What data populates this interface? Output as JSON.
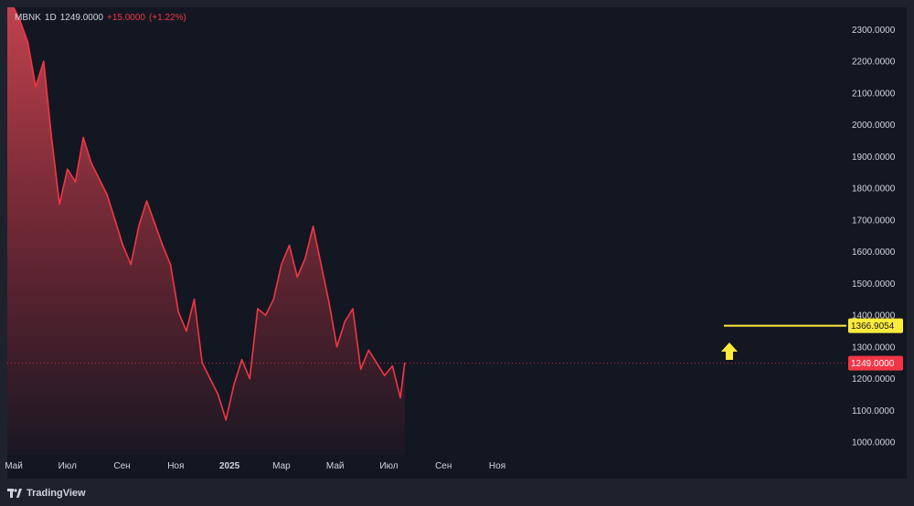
{
  "legend": {
    "symbol": "MBNK",
    "interval": "1D",
    "last": "1249.0000",
    "change": "+15.0000",
    "change_pct": "(+1.22%)"
  },
  "branding": {
    "name": "TradingView"
  },
  "colors": {
    "background": "#131722",
    "frame": "#1e222d",
    "line": "#f23645",
    "fill_top": "#f7525f",
    "target_line": "#ffeb3b",
    "last_price_badge": "#f23645",
    "arrow": "#ffeb3b"
  },
  "icons": [
    "tradingview-logo-icon",
    "arrow-up-icon"
  ],
  "chart_data": {
    "type": "area",
    "title": "",
    "xlabel": "",
    "ylabel": "",
    "ylim": [
      960,
      2370
    ],
    "y_ticks": [
      "2300.0000",
      "2200.0000",
      "2100.0000",
      "2000.0000",
      "1900.0000",
      "1800.0000",
      "1700.0000",
      "1600.0000",
      "1500.0000",
      "1400.0000",
      "1300.0000",
      "1200.0000",
      "1100.0000",
      "1000.0000"
    ],
    "x_ticks": [
      "Май",
      "Июл",
      "Сен",
      "Ноя",
      "2025",
      "Мар",
      "Май",
      "Июл",
      "Сен",
      "Ноя"
    ],
    "x": [
      "2024-04-20",
      "2024-04-29",
      "2024-05-08",
      "2024-05-17",
      "2024-05-26",
      "2024-06-04",
      "2024-06-13",
      "2024-06-22",
      "2024-07-01",
      "2024-07-10",
      "2024-07-19",
      "2024-07-28",
      "2024-08-06",
      "2024-08-15",
      "2024-08-24",
      "2024-09-02",
      "2024-09-11",
      "2024-09-20",
      "2024-09-29",
      "2024-10-08",
      "2024-10-17",
      "2024-10-26",
      "2024-11-04",
      "2024-11-13",
      "2024-11-22",
      "2024-12-01",
      "2024-12-10",
      "2024-12-19",
      "2024-12-28",
      "2025-01-06",
      "2025-01-15",
      "2025-01-24",
      "2025-02-02",
      "2025-02-11",
      "2025-02-20",
      "2025-03-01",
      "2025-03-10",
      "2025-03-19",
      "2025-03-28",
      "2025-04-06",
      "2025-04-15",
      "2025-04-24",
      "2025-05-03",
      "2025-05-12",
      "2025-05-21",
      "2025-05-30",
      "2025-06-08",
      "2025-06-17",
      "2025-06-26",
      "2025-07-05",
      "2025-07-14",
      "2025-07-19"
    ],
    "series": [
      {
        "values": [
          2540,
          2380,
          2330,
          2260,
          2120,
          2200,
          1960,
          1750,
          1860,
          1820,
          1960,
          1880,
          1830,
          1780,
          1700,
          1620,
          1560,
          1680,
          1760,
          1690,
          1620,
          1560,
          1410,
          1350,
          1450,
          1250,
          1200,
          1150,
          1070,
          1180,
          1260,
          1200,
          1420,
          1400,
          1450,
          1560,
          1620,
          1520,
          1580,
          1680,
          1560,
          1440,
          1300,
          1380,
          1420,
          1230,
          1290,
          1250,
          1210,
          1240,
          1140,
          1249
        ]
      }
    ],
    "last_price": "1249.0000",
    "target_level": {
      "label": "1366.9054",
      "value": 1366.9054
    }
  }
}
